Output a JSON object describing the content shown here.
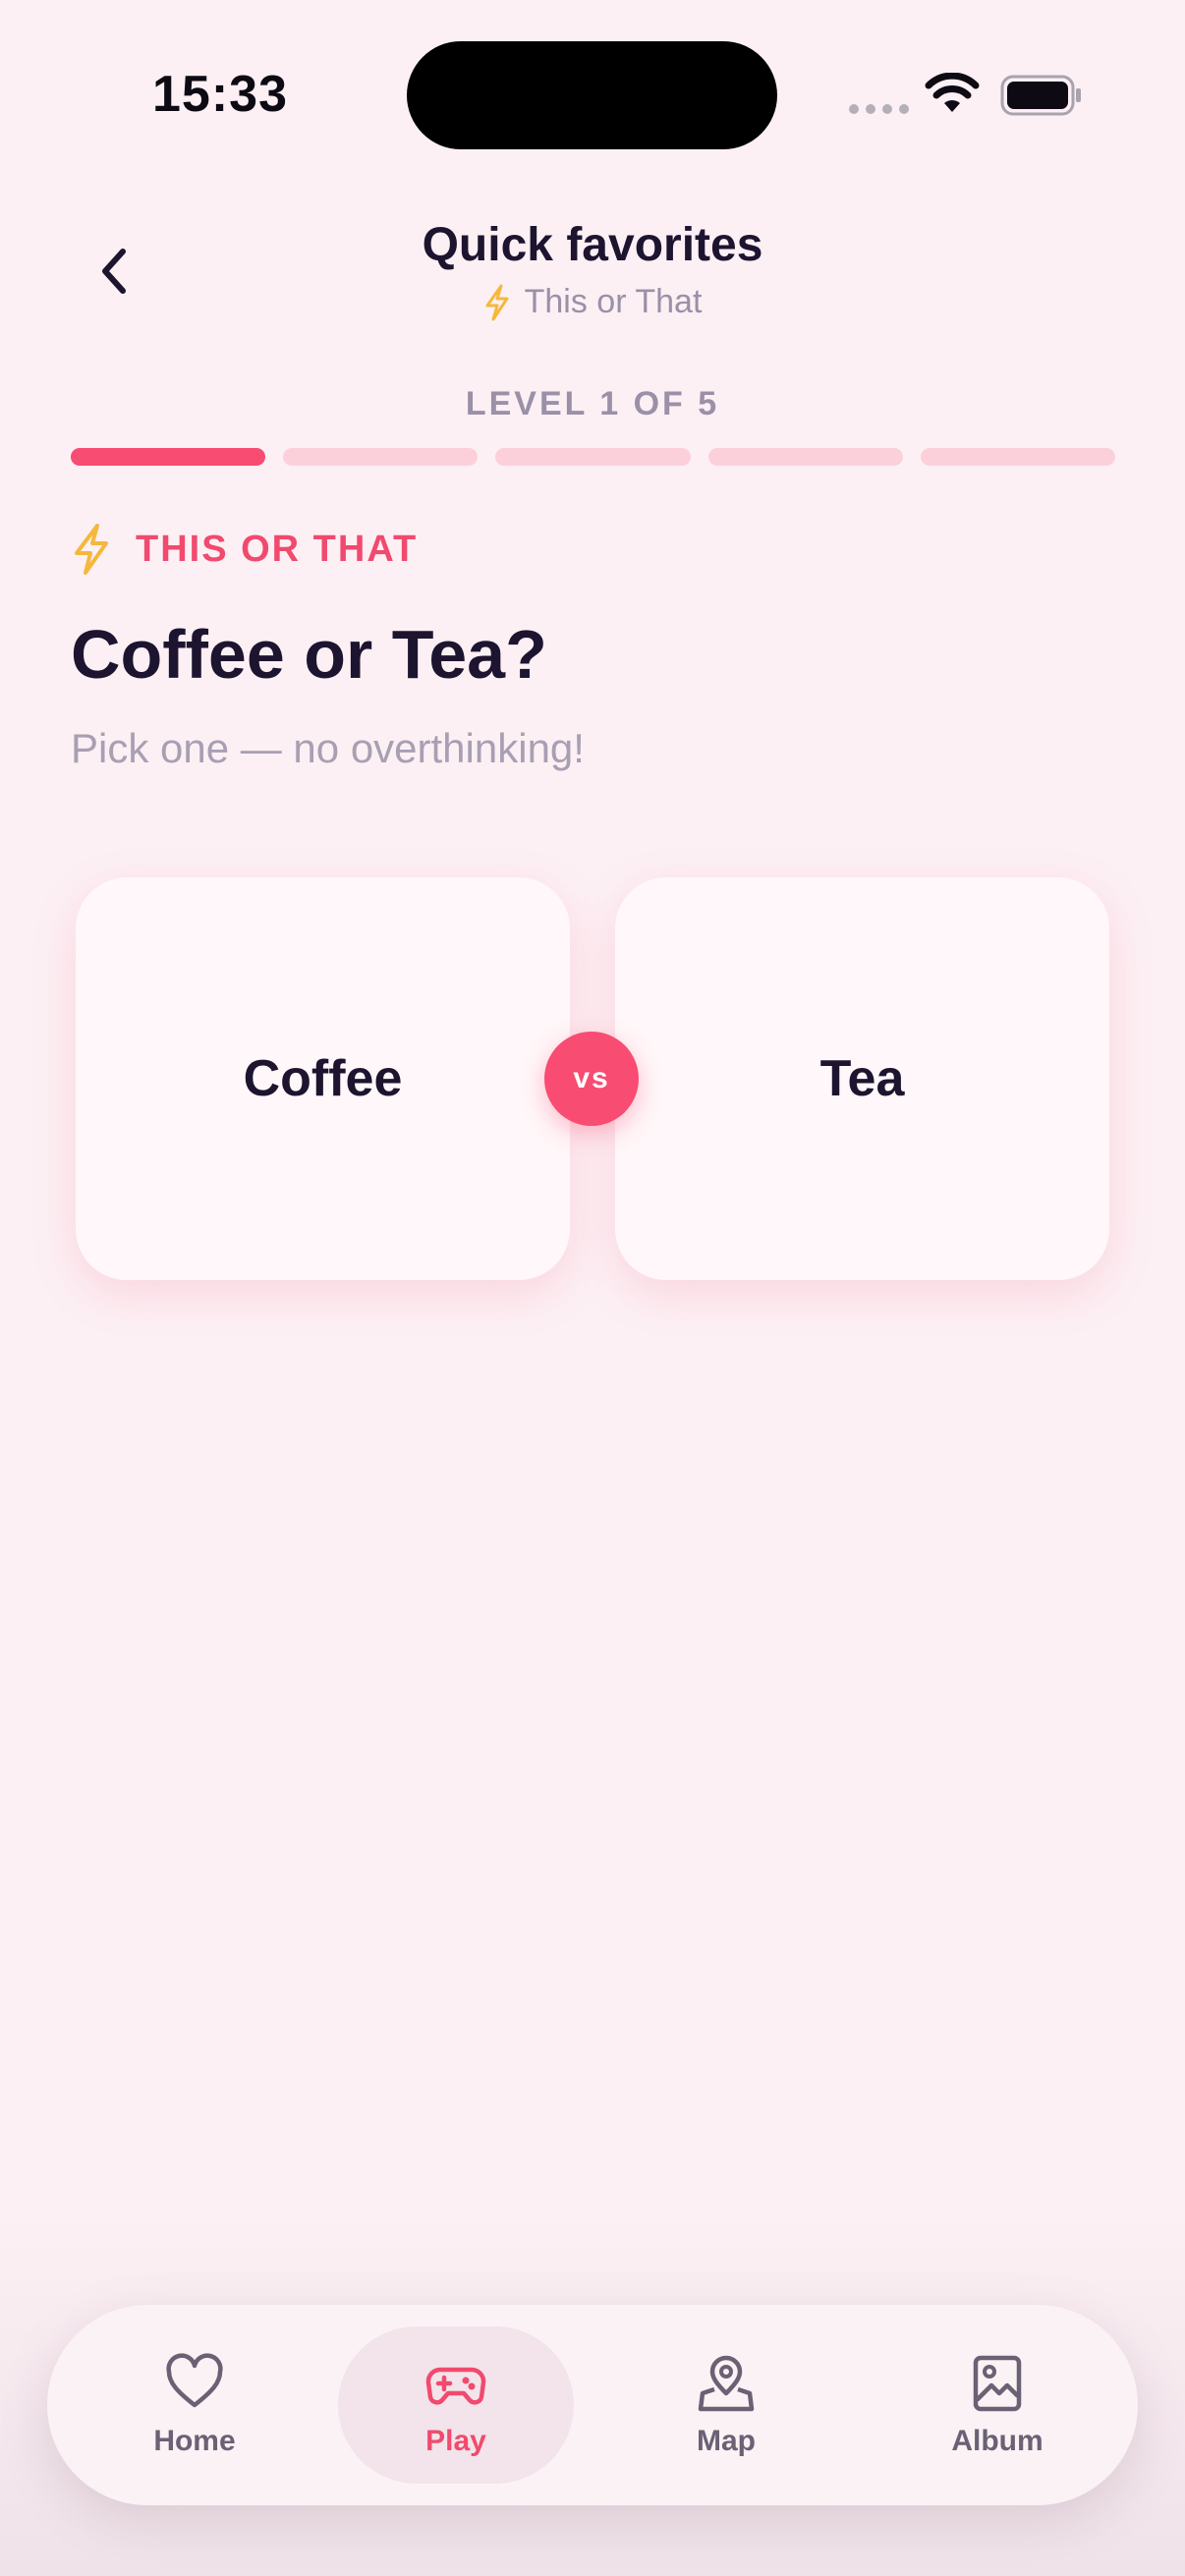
{
  "status_bar": {
    "time": "15:33"
  },
  "header": {
    "title": "Quick favorites",
    "subtitle": "This or That"
  },
  "progress": {
    "label": "LEVEL 1 OF 5",
    "current": 1,
    "total": 5
  },
  "question": {
    "category": "THIS OR THAT",
    "title": "Coffee or Tea?",
    "hint": "Pick one — no overthinking!"
  },
  "choices": {
    "left": "Coffee",
    "right": "Tea",
    "vs": "vs"
  },
  "tabbar": {
    "active": "Play",
    "items": [
      {
        "label": "Home",
        "icon": "heart-icon"
      },
      {
        "label": "Play",
        "icon": "gamepad-icon"
      },
      {
        "label": "Map",
        "icon": "map-pin-icon"
      },
      {
        "label": "Album",
        "icon": "image-icon"
      }
    ]
  },
  "colors": {
    "accent": "#f84c72",
    "background": "#fcf0f4",
    "bolt": "#f5b83d",
    "text": "#1d1430",
    "muted": "#9a90a8"
  }
}
